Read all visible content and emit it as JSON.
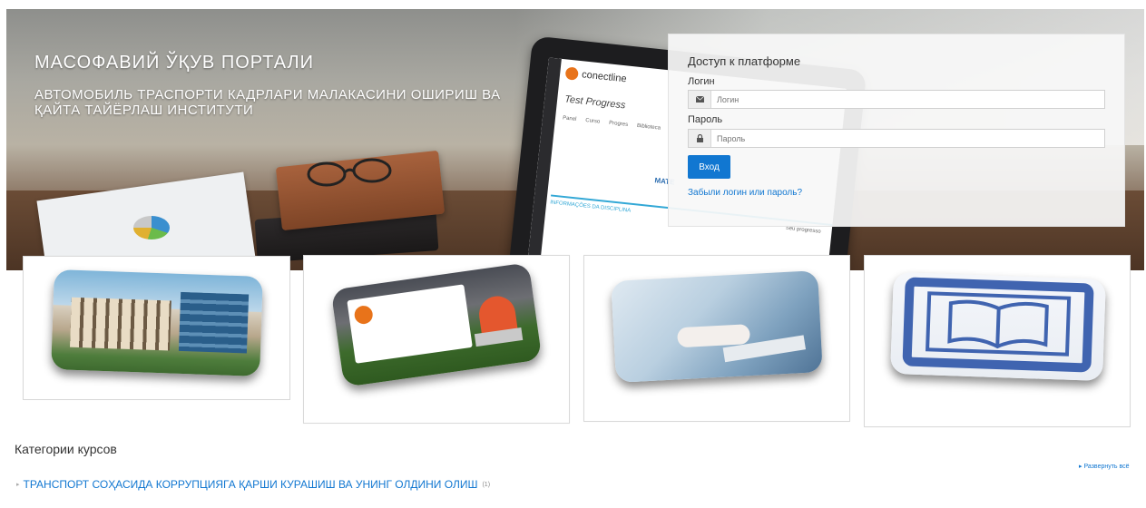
{
  "hero": {
    "title": "МАСОФАВИЙ ЎҚУВ ПОРТАЛИ",
    "subtitle": "АВТОМОБИЛЬ ТРАСПОРТИ КАДРЛАРИ МАЛАКАСИНИ ОШИРИШ ВА ҚАЙТА ТАЙЁРЛАШ ИНСТИТУТИ",
    "tablet_brand": "conectline",
    "tablet_heading": "Test Progress",
    "tablet_tabs": [
      "Panel",
      "Curso",
      "Progres",
      "Biblioteca"
    ],
    "tablet_section": "MATE",
    "tablet_info": "INFORMAÇÕES DA DISCIPLINA",
    "tablet_info_right": "Seu progresso"
  },
  "login": {
    "title": "Доступ к платформе",
    "username_label": "Логин",
    "username_placeholder": "Логин",
    "password_label": "Пароль",
    "password_placeholder": "Пароль",
    "submit_label": "Вход",
    "forgot_label": "Забыли логин или пароль?"
  },
  "categories": {
    "heading": "Категории курсов",
    "expand_all": "Развернуть всё",
    "items": [
      {
        "label": "ТРАНСПОРТ СОҲАСИДА КОРРУПЦИЯГА ҚАРШИ КУРАШИШ ВА УНИНГ ОЛДИНИ ОЛИШ",
        "count": "(1)"
      }
    ]
  },
  "colors": {
    "accent": "#1177d1",
    "card_border": "#d9d9d9"
  },
  "icons": {
    "username": "envelope-icon",
    "password": "lock-icon",
    "category_arrow": "triangle-right-icon",
    "card1": "institute-building-image",
    "card2": "student-laptop-image",
    "card3": "hands-keyboard-image",
    "card4": "open-book-icon"
  }
}
